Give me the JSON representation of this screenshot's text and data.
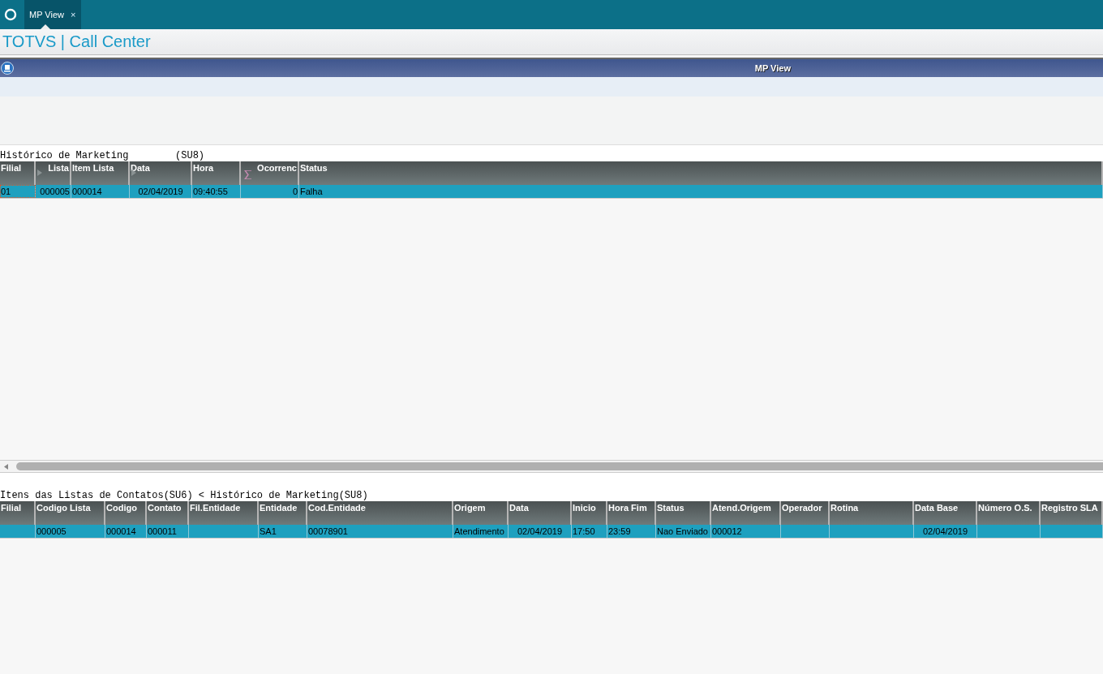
{
  "tabs": [
    {
      "label": "MP View",
      "selected": true,
      "close": "×"
    }
  ],
  "app_title": "TOTVS | Call Center",
  "dialog": {
    "title": "MP View"
  },
  "grids": [
    {
      "title": "Histórico de Marketing        (SU8)",
      "columns": [
        {
          "label": "Filial"
        },
        {
          "label": "Lista",
          "sortable": true
        },
        {
          "label": "Item Lista"
        },
        {
          "label": "Data",
          "sortable": true
        },
        {
          "label": "Hora"
        },
        {
          "label": "Ocorrenc",
          "summed": true
        },
        {
          "label": "Status"
        }
      ],
      "rows": [
        {
          "selected": true,
          "cells": [
            {
              "text": "01",
              "focused": true
            },
            {
              "text": "000005",
              "focused": false
            },
            {
              "text": "000014",
              "focused": false
            },
            {
              "text": "02/04/2019",
              "focused": false
            },
            {
              "text": "09:40:55",
              "focused": false
            },
            {
              "text": "0",
              "focused": false
            },
            {
              "text": "Falha",
              "focused": false
            }
          ]
        }
      ]
    },
    {
      "title": "Itens das Listas de Contatos(SU6) < Histórico de Marketing(SU8)",
      "columns": [
        {
          "label": "Filial"
        },
        {
          "label": "Codigo Lista"
        },
        {
          "label": "Codigo"
        },
        {
          "label": "Contato"
        },
        {
          "label": "Fil.Entidade"
        },
        {
          "label": "Entidade"
        },
        {
          "label": "Cod.Entidade"
        },
        {
          "label": "Origem"
        },
        {
          "label": "Data"
        },
        {
          "label": "Inicio"
        },
        {
          "label": "Hora Fim"
        },
        {
          "label": "Status"
        },
        {
          "label": "Atend.Origem"
        },
        {
          "label": "Operador"
        },
        {
          "label": "Rotina"
        },
        {
          "label": "Data Base"
        },
        {
          "label": "Número O.S."
        },
        {
          "label": "Registro SLA"
        }
      ],
      "rows": [
        {
          "selected": true,
          "cells": [
            {
              "focused": false
            },
            {
              "text": "000005",
              "focused": false
            },
            {
              "text": "000014",
              "focused": false
            },
            {
              "text": "000011",
              "focused": false
            },
            {
              "focused": false
            },
            {
              "text": "SA1",
              "focused": false
            },
            {
              "text": "00078901",
              "focused": false
            },
            {
              "text": "Atendimento",
              "focused": false
            },
            {
              "text": "02/04/2019",
              "focused": false
            },
            {
              "text": "17:50",
              "focused": false
            },
            {
              "text": "23:59",
              "focused": false
            },
            {
              "text": "Nao Enviado",
              "focused": false
            },
            {
              "text": "000012",
              "focused": false
            },
            {
              "focused": false
            },
            {
              "focused": false
            },
            {
              "text": "02/04/2019",
              "focused": false
            },
            {
              "focused": false
            },
            {
              "focused": false
            }
          ]
        }
      ]
    }
  ]
}
